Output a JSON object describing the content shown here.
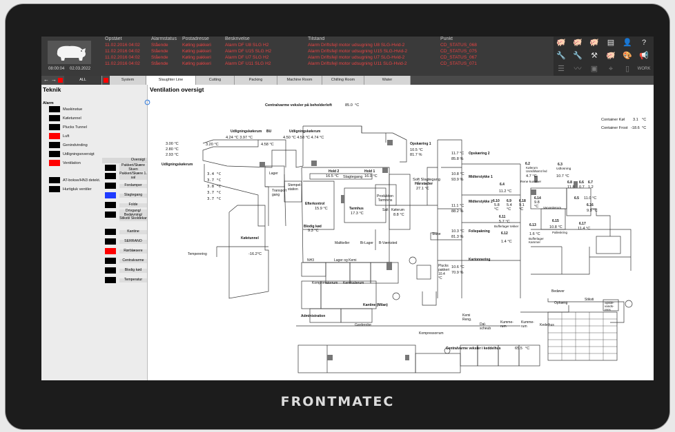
{
  "brand": "FRONTMATEC",
  "clock": {
    "time": "08:00:04",
    "date": "02.03.2022"
  },
  "alarm_table": {
    "headers": [
      "Opstået",
      "Alarmstatus",
      "Postadresse",
      "Beskrivelse",
      "Tilstand",
      "Punkt"
    ],
    "rows": [
      [
        "11.02.2016 04:02",
        "Stående",
        "Køling pakkeri",
        "Alarm DF U8 SLG H2",
        "Alarm Driftsfejl motor udsugning U8 SLG-Hvid-2",
        "CD_STATUS_068"
      ],
      [
        "11.02.2016 04:02",
        "Stående",
        "Køling pakkeri",
        "Alarm DF U15 SLG H2",
        "Alarm Driftsfejl motor udsugning U15 SLG-Hvid-2",
        "CD_STATUS_075"
      ],
      [
        "11.02.2016 04:02",
        "Stående",
        "Køling pakkeri",
        "Alarm DF U7 SLG H2",
        "Alarm Driftsfejl motor udsugning U7 SLG-Hvid-2",
        "CD_STATUS_067"
      ],
      [
        "11.02.2016 04:02",
        "Stående",
        "Køling pakkeri",
        "Alarm DF U11 SLG H2",
        "Alarm Driftsfejl motor udsugning U11 SLG-Hvid-2",
        "CD_STATUS_071"
      ]
    ],
    "alarm_color": "#e84343"
  },
  "icons_row1": [
    "pig-icon",
    "pig-wrench-icon",
    "pig-up-icon",
    "notepad-icon",
    "user-icon",
    "help-icon"
  ],
  "icons_row2": [
    "wrench-icon",
    "wrench-pig-icon",
    "tools-icon",
    "pig-arrow-icon",
    "palette-icon",
    "megaphone-icon"
  ],
  "icons_row3": [
    "sliders-icon",
    "trend-icon",
    "printer-icon",
    "location-icon",
    "document-icon"
  ],
  "work_label": "WORK",
  "tabs": [
    "ALL",
    "System",
    "Slaughter Line",
    "Cutting",
    "Packing",
    "Machine Room",
    "Chilling Room",
    "Water"
  ],
  "left": {
    "title": "Teknik",
    "alarm_label": "Alarm",
    "items": [
      {
        "label": "Maskinstue",
        "color": "#000000"
      },
      {
        "label": "Køletunnel",
        "color": "#000000"
      },
      {
        "label": "Plucks Tunnel",
        "color": "#000000"
      },
      {
        "label": "Luft",
        "color": "#ff0000"
      },
      {
        "label": "Genindvinding",
        "color": "#000000"
      },
      {
        "label": "Udligningsoversigt",
        "color": "#000000"
      },
      {
        "label": "Ventilation",
        "color": "#ff0000"
      },
      {
        "label": "AT-bokse/HN3 detekt.",
        "color": "#000000"
      },
      {
        "label": "Hurtigluk ventiler",
        "color": "#000000"
      }
    ],
    "overview_header": "Oversigt",
    "overview": [
      {
        "label": "Pakkeri/Skære Stuen",
        "color": "#000000"
      },
      {
        "label": "Pakkeri/Skære 1. sal",
        "color": "#000000"
      },
      {
        "label": "Fordamper",
        "color": "#000000"
      },
      {
        "label": "Slagtegang",
        "color": "#1e3bff"
      },
      {
        "label": "Folde",
        "color": "#000000"
      },
      {
        "label": "Drivgang/ Bedøvning/ Stiksti/ Skoldekar",
        "color": "#000000"
      },
      {
        "label": "Kantine",
        "color": "#000000"
      },
      {
        "label": "SERRANO",
        "color": "#000000"
      },
      {
        "label": "Rørblæsere",
        "color": "#ff0000"
      },
      {
        "label": "Centralvarme",
        "color": "#000000"
      },
      {
        "label": "Blodig kød",
        "color": "#000000"
      },
      {
        "label": "Temperatur",
        "color": "#000000"
      }
    ]
  },
  "main": {
    "title": "Ventilation oversigt",
    "central_top": "Centralvarme veksler på beholderloft",
    "central_top_val": "85.0",
    "unit_c": "°C",
    "container_kol": "Container Køl",
    "container_kol_val": "3.1",
    "container_frost": "Container Frost",
    "container_frost_val": "-18.6",
    "central_bottom": "Centralvarme veksler i keddelhus",
    "central_bottom_val": "65.5",
    "labels": {
      "udl1": "Udligningskølerum",
      "udl1_v": "4.24 °C   3.97 °C",
      "bu": "BU",
      "udl2": "Udligningskølerum",
      "udl2_v": "4.50 °C   4.58 °C   4.74 °C",
      "t300": "3.00 °C",
      "t280": "2.80 °C",
      "t293": "2.93 °C",
      "t320": "3.20 °C",
      "t458": "4.58 °C",
      "udl3": "Udligningskølerum",
      "t34": "3.4 °C",
      "t37a": "3.7 °C",
      "t38": "3.8 °C",
      "t37b": "3.7 °C",
      "t37c": "3.7 °C",
      "lager": "Lager",
      "transport": "Transport gang",
      "stempel": "Stempel- station",
      "hold2": "Hold 2",
      "hold2_v": "16.5 °C",
      "slagtegang": "Slagtegang",
      "hold1": "Hold 1",
      "hold1_v": "16.0 °C",
      "opsk1": "Opskæring 1",
      "opsk1_v": "10.5 °C",
      "opsk1_h": "81.7 %",
      "soft": "Soft Slagtegang",
      "harstader": "Hårstader",
      "harstader_v": "27.1 °C",
      "efterkontrol": "Efterkontrol",
      "efterkontrol_v": "15.9 °C",
      "produktion": "Produktion Tarmrens",
      "tarmhus": "Tarmhus",
      "tarmhus_v": "17.3 °C",
      "salt": "Salt",
      "kelerum": "Kølerum",
      "kelerum_v": "8.8 °C",
      "blodig": "Blodig kød",
      "blodig_v": "9.3 °C",
      "maltkeller": "Maltkeller",
      "bilager": "Bi-Lager",
      "bvaerksted": "B-Værksted",
      "nh3": "NH3",
      "lagerkemi": "Lager og Kemi",
      "kompressor": "Komprimatorrum",
      "kemikalie": "Kemikalierum",
      "keletunnel": "Køletunnel",
      "keletunnel_v": "-16.2°C",
      "temperering": "Temperering",
      "opsk2": "Opskæring 2",
      "opsk2_v": "11.7 °C",
      "opsk2_h": "85.8 %",
      "midter1": "Midterstykke 1",
      "midter1_v": "10.8 °C",
      "midter1_h": "93.9 %",
      "midter2": "Midterstykke 2",
      "midter2_v": "11.1 °C",
      "midter2_h": "88.2 %",
      "folie": "Foliepakning",
      "folie_v": "10.3 °C",
      "folie_h": "81.3 %",
      "karton": "Kartonnering",
      "karton_v": "10.6 °C",
      "karton_h": "70.9 %",
      "sluse": "Sluse",
      "plucks": "Plucks pakkeri",
      "plucks_v": "10.4 °C",
      "kantine": "Kantine (Milan)",
      "admin": "Administration",
      "garderobe": "Garderobe",
      "kompressorrum": "Kompressorrum",
      "kemi": "Kemi Reng.",
      "dal": "Dal- scheub",
      "kummerum1": "Kumme- rum",
      "kummerum2": "Kumme- rum",
      "kedelhus": "Kedelhus",
      "r62": "6.2",
      "kolerum": "Kølerum Usmål/tømt fed",
      "r62_v": "4.7 °C",
      "r63": "6.3",
      "udlosning": "Udlosning",
      "r63_v": "10.7 °C",
      "r64": "6.4",
      "rene": "Rene kummer",
      "r64_v": "11.2 °C",
      "r68": "6.8",
      "r68_v": "11.8",
      "r66": "6.6",
      "r66_v": "0.7",
      "r67": "6.7",
      "r67_v": "1.2",
      "r610": "6.10",
      "r610_v": "5.8 °C",
      "r69": "6.9",
      "r69_v": "5.4 °C",
      "r618": "6.18",
      "r618_v": "9.1 °C",
      "r614": "6.14",
      "r614_v": "9.8 °C",
      "varvask": "Varvaskerum",
      "r65": "6.5",
      "r65_v": "11.0 °C",
      "r616": "6.16",
      "r616_v": "9.9 °C",
      "r611": "6.11",
      "r611_v": "5.7 °C",
      "buf1": "Bufferlager tekker",
      "r613": "6.13",
      "r615": "6.15",
      "r615_v": "10.8 °C",
      "pall": "Palleskring",
      "r617": "6.17",
      "r617_v": "11.4 °C",
      "r612": "6.12",
      "r612_v": "1.4 °C",
      "r613_v": "1.6 °C",
      "buf2": "Bufferlager Kammer",
      "bedover": "Bedøver",
      "opheng": "Ophæng",
      "stiksti": "Stiksti",
      "spilde": "Spilde- vands- rens"
    }
  }
}
